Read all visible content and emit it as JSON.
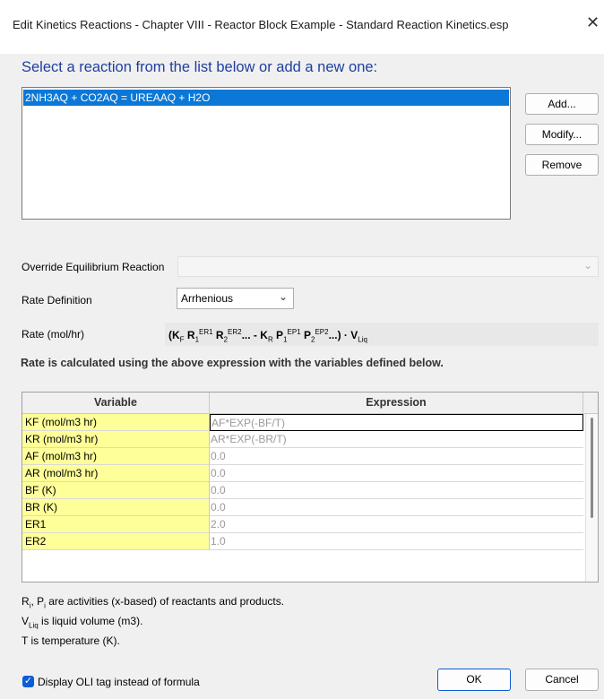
{
  "window": {
    "title": "Edit Kinetics Reactions - Chapter VIII - Reactor Block Example - Standard Reaction Kinetics.esp",
    "close_glyph": "✕"
  },
  "heading": "Select a reaction from the list below or add a new one:",
  "reactions": {
    "items": [
      "2NH3AQ + CO2AQ = UREAAQ + H2O"
    ],
    "selected_index": 0
  },
  "buttons": {
    "add": "Add...",
    "modify": "Modify...",
    "remove": "Remove",
    "ok": "OK",
    "cancel": "Cancel"
  },
  "override": {
    "label": "Override Equilibrium Reaction",
    "value": ""
  },
  "rate_definition": {
    "label": "Rate Definition",
    "value": "Arrhenious"
  },
  "rate": {
    "label": "Rate (mol/hr)"
  },
  "note": "Rate is calculated using the above expression with the variables defined below.",
  "grid": {
    "headers": [
      "Variable",
      "Expression"
    ],
    "rows": [
      {
        "variable": "KF (mol/m3 hr)",
        "expression": "AF*EXP(-BF/T)"
      },
      {
        "variable": "KR (mol/m3 hr)",
        "expression": "AR*EXP(-BR/T)"
      },
      {
        "variable": "AF (mol/m3 hr)",
        "expression": "0.0"
      },
      {
        "variable": "AR (mol/m3 hr)",
        "expression": "0.0"
      },
      {
        "variable": "BF (K)",
        "expression": "0.0"
      },
      {
        "variable": "BR (K)",
        "expression": "0.0"
      },
      {
        "variable": "ER1",
        "expression": "2.0"
      },
      {
        "variable": "ER2",
        "expression": "1.0"
      }
    ]
  },
  "footnotes": {
    "line1_rest": "are activities (x-based) of reactants and products.",
    "line2_rest": "is liquid volume (m3).",
    "line3": "T is temperature (K)."
  },
  "display_tag": {
    "label": "Display OLI tag instead of formula",
    "checked": true
  },
  "colors": {
    "heading": "#1f3fa0",
    "selection": "#0b78d7",
    "variable_cell": "#ffff99"
  }
}
